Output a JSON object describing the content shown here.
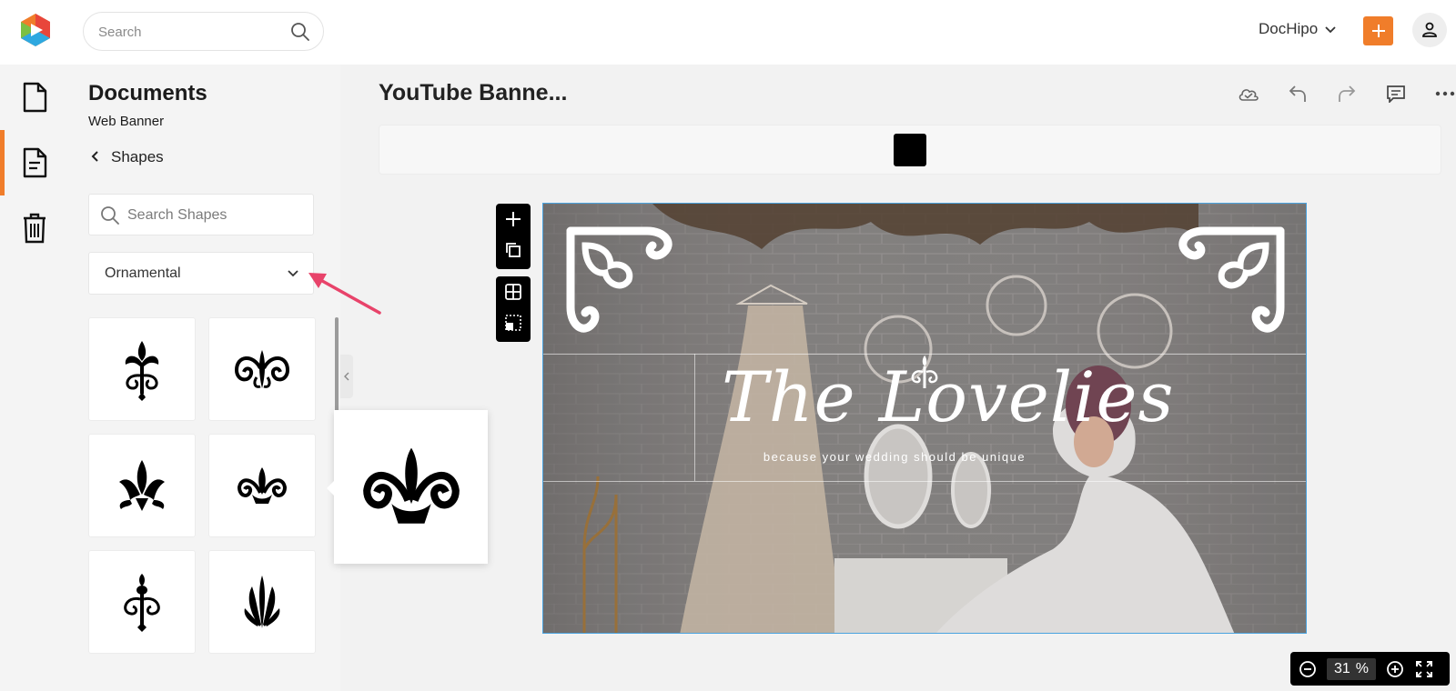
{
  "header": {
    "search_placeholder": "Search",
    "account_name": "DocHipo",
    "brand_color": "#f07d2a"
  },
  "rail": {
    "items": [
      {
        "icon": "file-icon",
        "active": false
      },
      {
        "icon": "document-icon",
        "active": true
      },
      {
        "icon": "trash-icon",
        "active": false
      }
    ]
  },
  "panel": {
    "title": "Documents",
    "subtitle": "Web Banner",
    "back_label": "Shapes",
    "search_placeholder": "Search Shapes",
    "category": "Ornamental"
  },
  "document": {
    "title": "YouTube Banne...",
    "fill_color": "#000000"
  },
  "canvas": {
    "title": "The Lovelies",
    "tagline": "because your wedding should be unique"
  },
  "zoom": {
    "value": "31",
    "unit": "%"
  }
}
